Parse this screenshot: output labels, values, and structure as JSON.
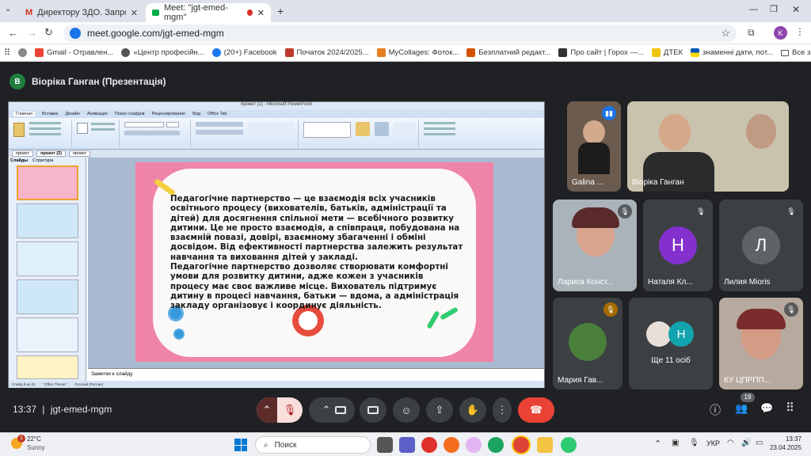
{
  "browser": {
    "tabs": [
      {
        "title": "Директору ЗДО. Запрошення"
      },
      {
        "title": "Meet: \"jgt-emed-mgm\""
      }
    ],
    "url": "meet.google.com/jgt-emed-mgm",
    "profile_initial": "K",
    "bookmarks": [
      "Gmail - Отравлен...",
      "«Центр професійн...",
      "(20+) Facebook",
      "Початок 2024/2025...",
      "MyCollages: Фоток...",
      "Безплатний редакт...",
      "Про сайт | Горох —...",
      "ДТЕК",
      "знаменні дати, пот..."
    ],
    "all_bookmarks": "Все закладки"
  },
  "meet": {
    "presenter_initial": "В",
    "presenter_label": "Віоріка Ганган (Презентація)",
    "participants": [
      {
        "name": "Galina ..."
      },
      {
        "name": "Віоріка Ганган"
      },
      {
        "name": "Лариса Конст..."
      },
      {
        "name": "Наталя Кл...",
        "initial": "Н"
      },
      {
        "name": "Лилия Miorіs",
        "initial": "Л"
      },
      {
        "name": "Мария Гав..."
      },
      {
        "name": "Ще 11 осіб",
        "initial": "Н"
      },
      {
        "name": "КУ ЦПРПП..."
      }
    ],
    "time": "13:37",
    "meeting_code": "jgt-emed-mgm",
    "people_count": "19"
  },
  "powerpoint": {
    "window_title": "проект (2) - Microsoft PowerPoint",
    "ribbon_tabs": [
      "Главная",
      "Вставка",
      "Дизайн",
      "Анимация",
      "Показ слайдов",
      "Рецензирование",
      "Вид",
      "Office Tab"
    ],
    "doc_tabs": [
      "проект",
      "проект (2)",
      "проект"
    ],
    "panel_tabs": [
      "Слайды",
      "Структура"
    ],
    "notes_placeholder": "Заметки к слайду",
    "status": [
      "Слайд 8 из 33",
      "\"Office Theme\"",
      "Русский (Россия)"
    ],
    "slide_paragraph_1": "Педагогічне партнерство — це взаємодія всіх учасників освітнього процесу (вихователів, батьків, адміністрації та дітей) для досягнення спільної мети — всебічного розвитку дитини. Це не просто взаємодія, а співпраця, побудована на взаємній повазі, довірі, взаємному збагаченні і обміні досвідом. Від ефективності партнерства залежить результат навчання та виховання дітей у закладі.",
    "slide_paragraph_2": "Педагогічне партнерство дозволяє створювати комфортні умови для розвитку дитини, адже кожен з учасників процесу має своє важливе місце. Вихователь підтримує дитину в процесі навчання, батьки — вдома, а адміністрація закладу організовує і координує діяльність."
  },
  "taskbar": {
    "temperature": "22°C",
    "weather": "Sunny",
    "search_placeholder": "Поиск",
    "language": "УКР",
    "time": "13:37",
    "date": "23.04.2025"
  }
}
